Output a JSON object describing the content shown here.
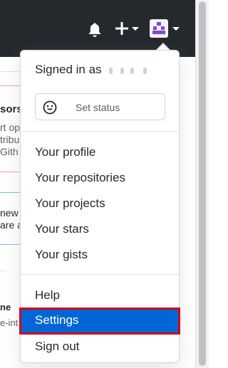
{
  "header": {
    "icons": [
      "bell-icon",
      "plus-icon",
      "avatar-icon"
    ],
    "colors": {
      "background": "#24292e",
      "icon": "#ffffff"
    }
  },
  "background_page": {
    "fragments": [
      "sors",
      "rt op",
      "tribu",
      "Gith",
      "new c",
      "are a",
      "ne",
      "e-int"
    ]
  },
  "dropdown": {
    "signed_in_label": "Signed in as",
    "status_button": {
      "icon": "smiley-icon",
      "label": "Set status"
    },
    "section_1": [
      "Your profile",
      "Your repositories",
      "Your projects",
      "Your stars",
      "Your gists"
    ],
    "section_2": [
      "Help",
      "Settings",
      "Sign out"
    ],
    "selected_item": "Settings",
    "colors": {
      "highlight": "#0366d6",
      "highlight_border": "#d0021b"
    }
  }
}
